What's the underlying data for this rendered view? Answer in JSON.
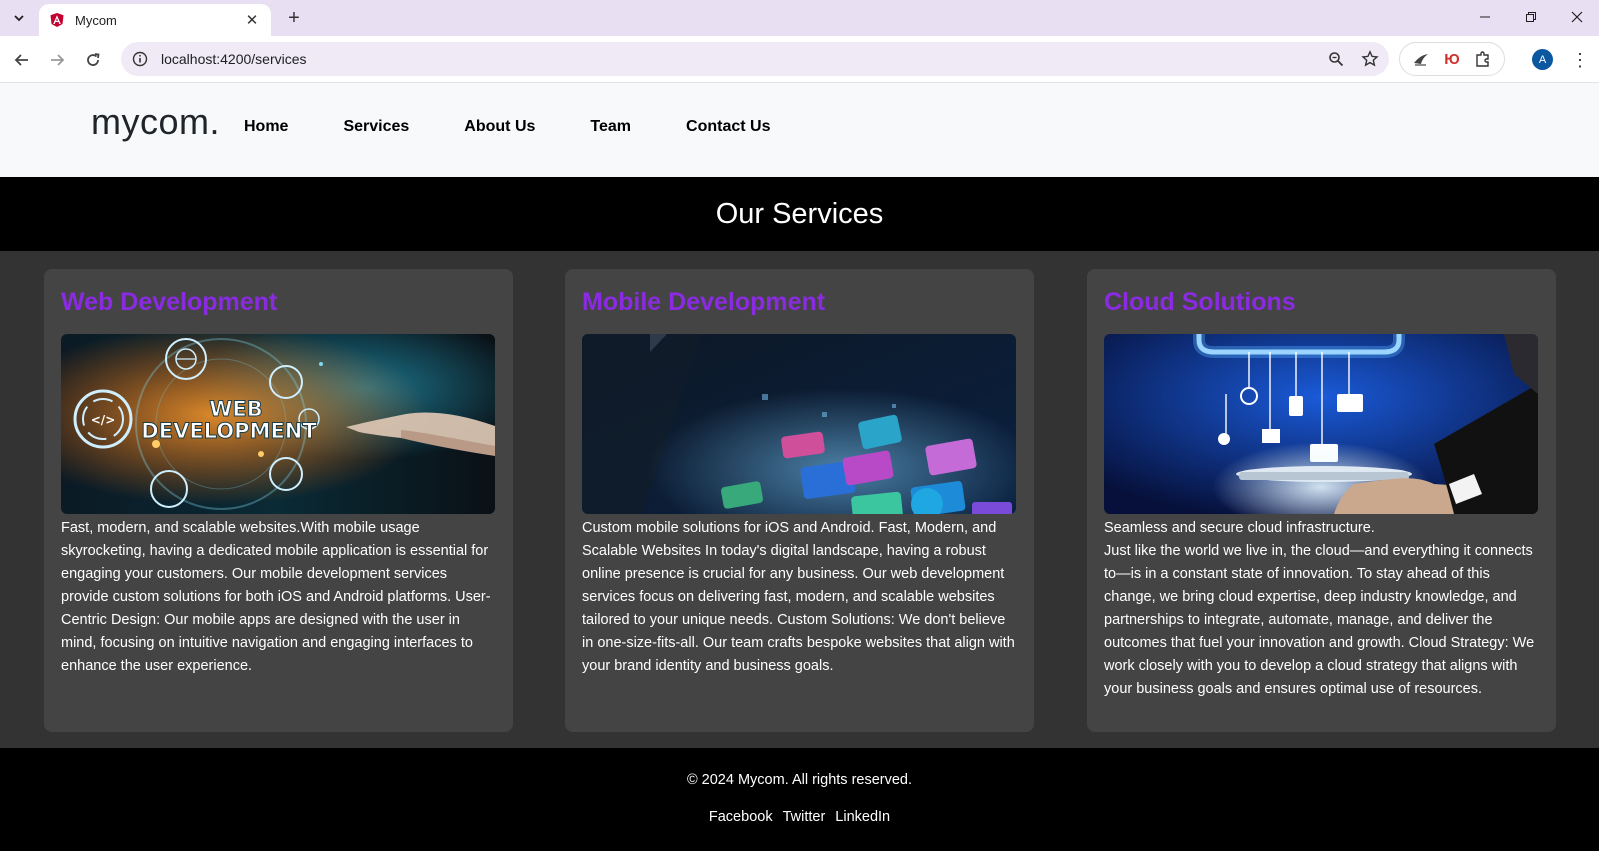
{
  "browser": {
    "tab_title": "Mycom",
    "url": "localhost:4200/services",
    "profile_initial": "A",
    "ext_translate_label": "Ю"
  },
  "site": {
    "logo": "mycom.",
    "nav": [
      "Home",
      "Services",
      "About Us",
      "Team",
      "Contact Us"
    ],
    "page_heading": "Our Services",
    "accent_color": "#8a2be2"
  },
  "services": [
    {
      "title": "Web Development",
      "image_label": [
        "WEB",
        "DEVELOPMENT"
      ],
      "description": "Fast, modern, and scalable websites.With mobile usage skyrocketing, having a dedicated mobile application is essential for engaging your customers. Our mobile development services provide custom solutions for both iOS and Android platforms. User-Centric Design: Our mobile apps are designed with the user in mind, focusing on intuitive navigation and engaging interfaces to enhance the user experience."
    },
    {
      "title": "Mobile Development",
      "description": "Custom mobile solutions for iOS and Android. Fast, Modern, and Scalable Websites In today's digital landscape, having a robust online presence is crucial for any business. Our web development services focus on delivering fast, modern, and scalable websites tailored to your unique needs. Custom Solutions: We don't believe in one-size-fits-all. Our team crafts bespoke websites that align with your brand identity and business goals."
    },
    {
      "title": "Cloud Solutions",
      "description": "Seamless and secure cloud infrastructure.",
      "description_2": "Just like the world we live in, the cloud—and everything it connects to—is in a constant state of innovation. To stay ahead of this change, we bring cloud expertise, deep industry knowledge, and partnerships to integrate, automate, manage, and deliver the outcomes that fuel your innovation and growth. Cloud Strategy: We work closely with you to develop a cloud strategy that aligns with your business goals and ensures optimal use of resources."
    }
  ],
  "footer": {
    "copyright": "© 2024 Mycom. All rights reserved.",
    "links": [
      "Facebook",
      "Twitter",
      "LinkedIn"
    ]
  }
}
